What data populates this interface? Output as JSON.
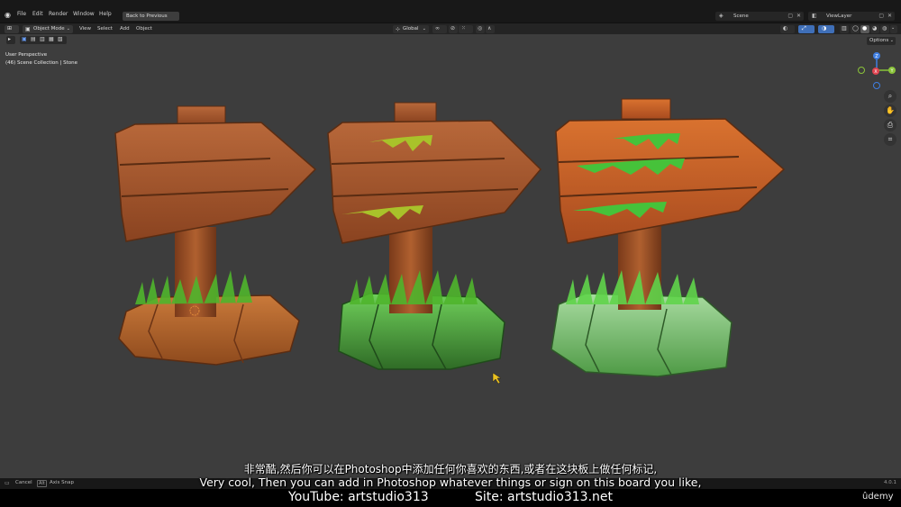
{
  "menu": {
    "items": [
      "File",
      "Edit",
      "Render",
      "Window",
      "Help"
    ],
    "back_button": "Back to Previous"
  },
  "top_right": {
    "scene": "Scene",
    "view_layer": "ViewLayer"
  },
  "header": {
    "mode": "Object Mode",
    "menus": [
      "View",
      "Select",
      "Add",
      "Object"
    ],
    "orientation": "Global"
  },
  "viewport": {
    "perspective": "User Perspective",
    "collection": "(46) Scene Collection | Stone",
    "options": "Options"
  },
  "gizmo": {
    "z": "Z",
    "y": "Y",
    "x": "X"
  },
  "status": {
    "cancel": "Cancel",
    "alt_key": "Alt",
    "axis_snap": "Axis Snap",
    "version": "4.0.1"
  },
  "subtitles": {
    "chinese": "非常酷,然后你可以在Photoshop中添加任何你喜欢的东西,或者在这块板上做任何标记,",
    "english": "Very cool, Then you can add in Photoshop whatever things or sign on this board you like,"
  },
  "watermark": {
    "youtube": "YouTube: artstudio313",
    "site": "Site: artstudio313.net",
    "brand": "ûdemy"
  },
  "colors": {
    "viewport_bg": "#3d3d3d",
    "wood": "#a65a2a",
    "wood_dark": "#6e3518",
    "moss_green": "#5dbf3c",
    "stone_orange": "#b5692f",
    "stone_green": "#3f8a35",
    "axis_x": "#e0434f",
    "axis_y": "#8ac33a",
    "axis_z": "#3f7ee2"
  }
}
